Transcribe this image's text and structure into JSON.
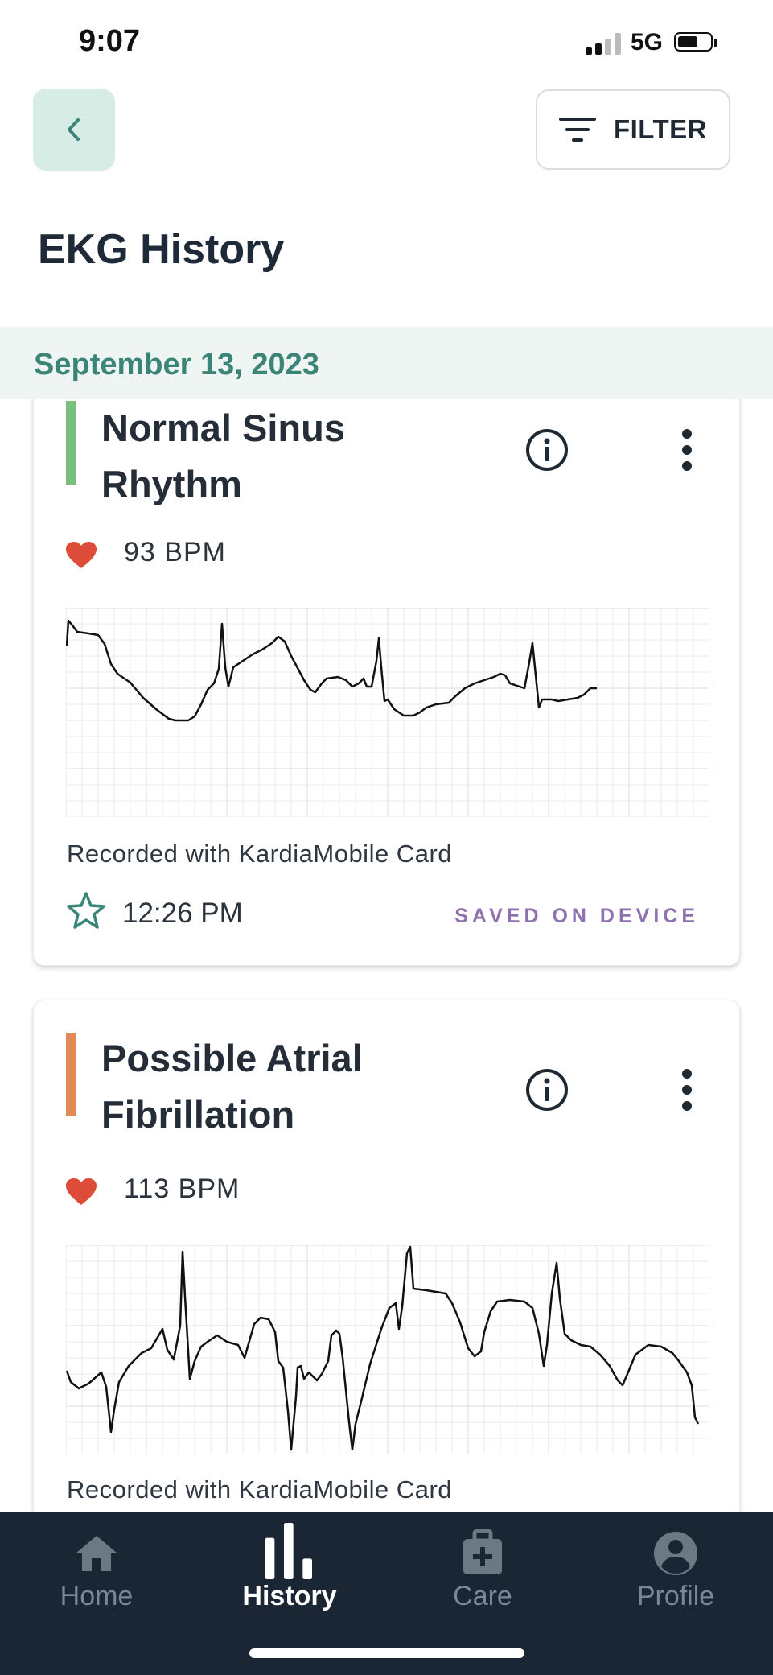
{
  "status_bar": {
    "time": "9:07",
    "network": "5G"
  },
  "header": {
    "back_icon": "chevron-left-icon",
    "filter_label": "FILTER",
    "filter_icon": "filter-lines-icon"
  },
  "page_title": "EKG History",
  "date_group": "September 13, 2023",
  "recordings": [
    {
      "title_line1": "Normal Sinus",
      "title_line2": "Rhythm",
      "accent_color": "#7bbf7e",
      "bpm": "93 BPM",
      "device": "Recorded with KardiaMobile Card",
      "time": "12:26 PM",
      "status": "SAVED ON DEVICE"
    },
    {
      "title_line1": "Possible Atrial",
      "title_line2": "Fibrillation",
      "accent_color": "#e48a58",
      "bpm": "113 BPM",
      "device": "Recorded with KardiaMobile Card"
    }
  ],
  "colors": {
    "heart": "#dd4b39",
    "star": "#3a8577",
    "status_text": "#8e72b0",
    "tab_bar": "#1b2634",
    "accent_green": "#3a8577"
  },
  "tabs": [
    {
      "label": "Home",
      "icon": "home-icon",
      "active": false
    },
    {
      "label": "History",
      "icon": "bar-chart-icon",
      "active": true
    },
    {
      "label": "Care",
      "icon": "medical-bag-icon",
      "active": false
    },
    {
      "label": "Profile",
      "icon": "profile-icon",
      "active": false
    }
  ]
}
